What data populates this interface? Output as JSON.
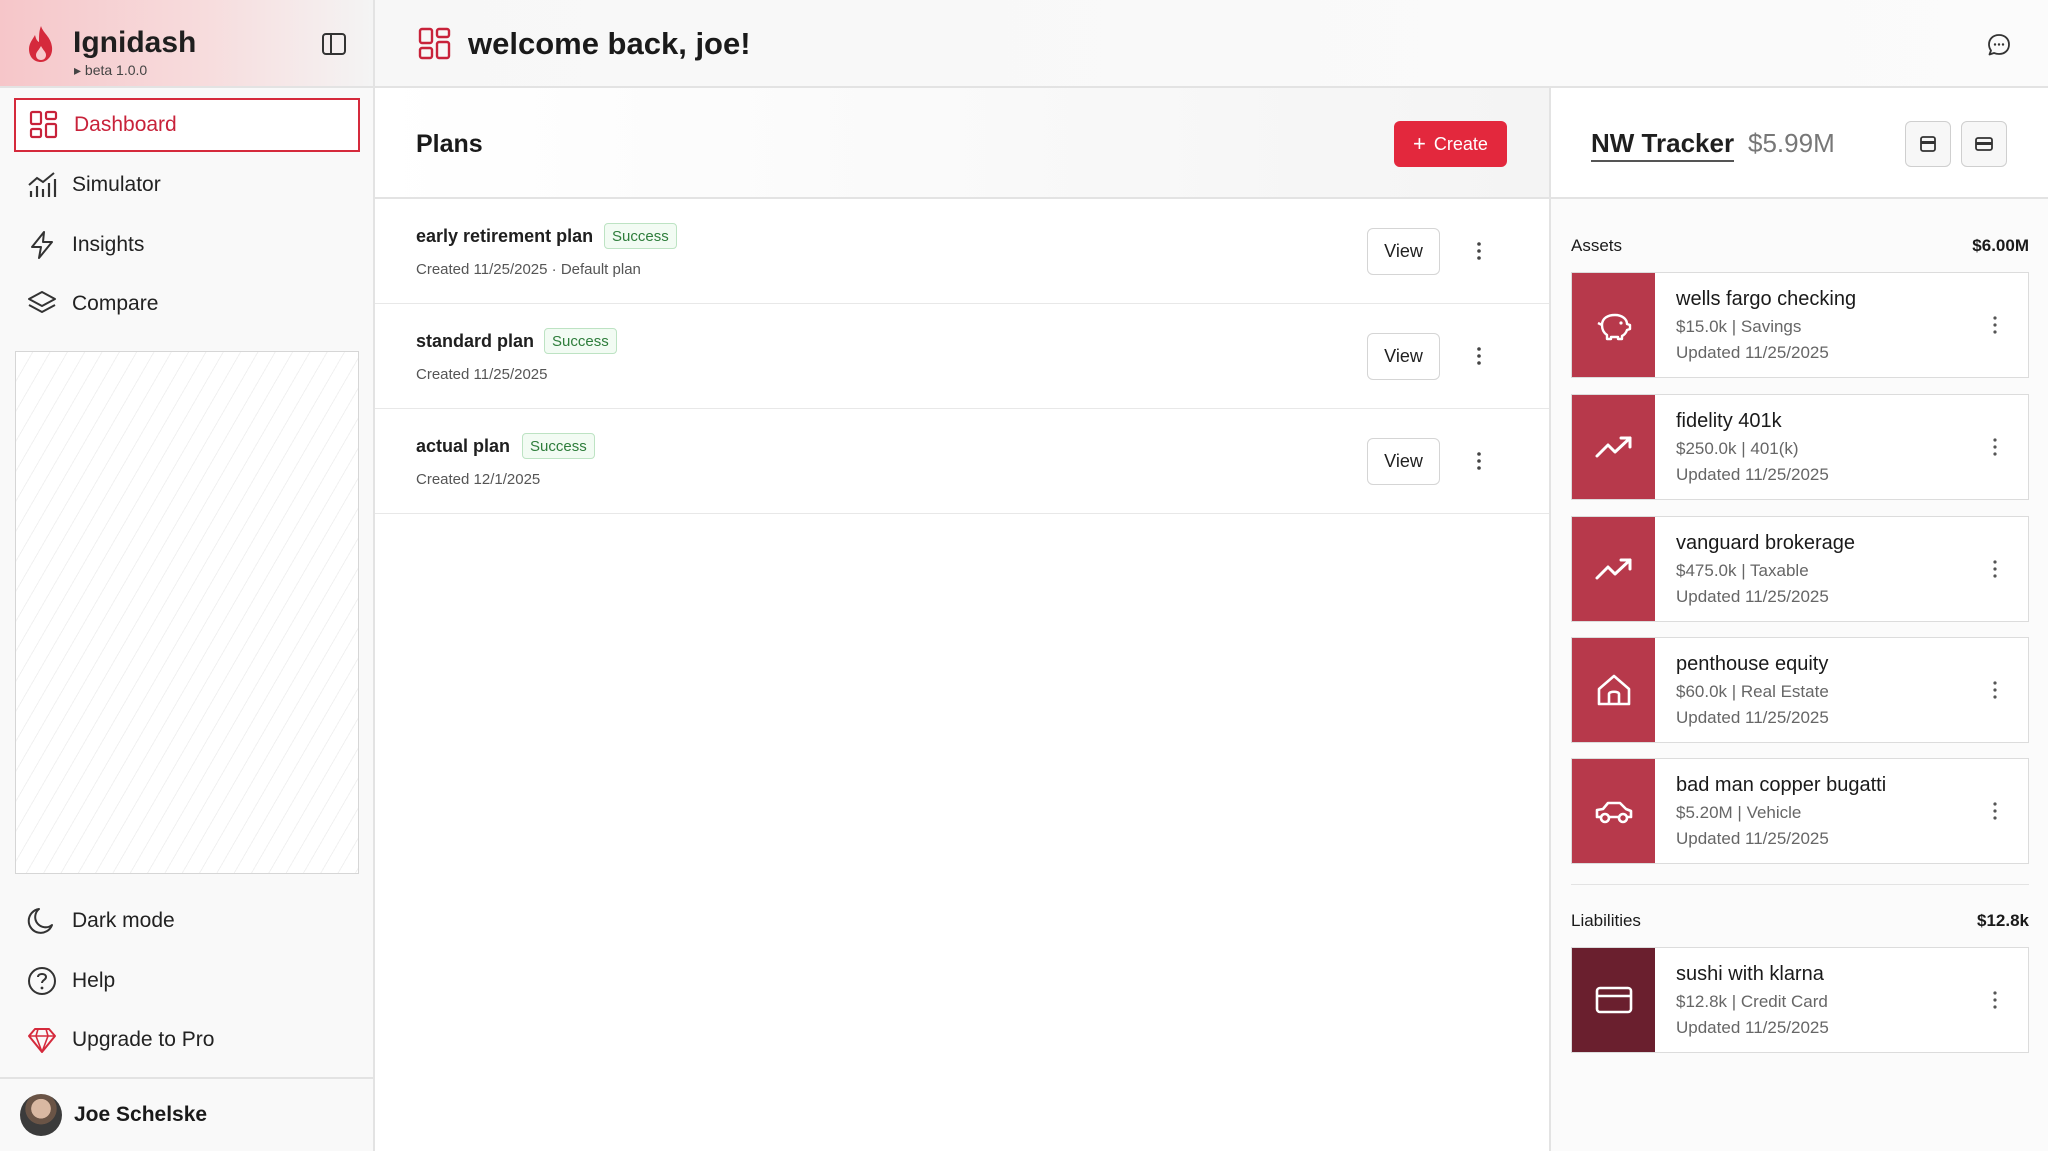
{
  "brand": {
    "name": "Ignidash",
    "version": "beta 1.0.0"
  },
  "nav": {
    "items": [
      {
        "label": "Dashboard"
      },
      {
        "label": "Simulator"
      },
      {
        "label": "Insights"
      },
      {
        "label": "Compare"
      }
    ],
    "bottom": [
      {
        "label": "Dark mode"
      },
      {
        "label": "Help"
      },
      {
        "label": "Upgrade to Pro"
      }
    ]
  },
  "user": {
    "name": "Joe Schelske"
  },
  "header": {
    "title": "welcome back, joe!"
  },
  "plans": {
    "title": "Plans",
    "create_label": "Create",
    "view_label": "View",
    "status_label": "Success",
    "rows": [
      {
        "name": "early retirement plan",
        "status": "Success",
        "meta": "Created 11/25/2025  ·  Default plan"
      },
      {
        "name": "standard plan",
        "status": "Success",
        "meta": "Created 11/25/2025"
      },
      {
        "name": "actual plan",
        "status": "Success",
        "meta": "Created 12/1/2025"
      }
    ]
  },
  "tracker": {
    "title": "NW Tracker",
    "value": "$5.99M",
    "assets": {
      "label": "Assets",
      "total": "$6.00M",
      "items": [
        {
          "name": "wells fargo checking",
          "detail": "$15.0k | Savings",
          "updated": "Updated 11/25/2025",
          "icon": "piggy-bank-icon"
        },
        {
          "name": "fidelity 401k",
          "detail": "$250.0k | 401(k)",
          "updated": "Updated 11/25/2025",
          "icon": "trending-up-icon"
        },
        {
          "name": "vanguard brokerage",
          "detail": "$475.0k | Taxable",
          "updated": "Updated 11/25/2025",
          "icon": "trending-up-icon"
        },
        {
          "name": "penthouse equity",
          "detail": "$60.0k | Real Estate",
          "updated": "Updated 11/25/2025",
          "icon": "home-icon"
        },
        {
          "name": "bad man copper bugatti",
          "detail": "$5.20M | Vehicle",
          "updated": "Updated 11/25/2025",
          "icon": "car-icon"
        }
      ]
    },
    "liabilities": {
      "label": "Liabilities",
      "total": "$12.8k",
      "items": [
        {
          "name": "sushi with klarna",
          "detail": "$12.8k | Credit Card",
          "updated": "Updated 11/25/2025",
          "icon": "credit-card-icon"
        }
      ]
    }
  },
  "colors": {
    "accent": "#e3283d",
    "tile": "#b7394b",
    "tile_dark": "#6a1f2e",
    "success": "#2e7d3b"
  }
}
